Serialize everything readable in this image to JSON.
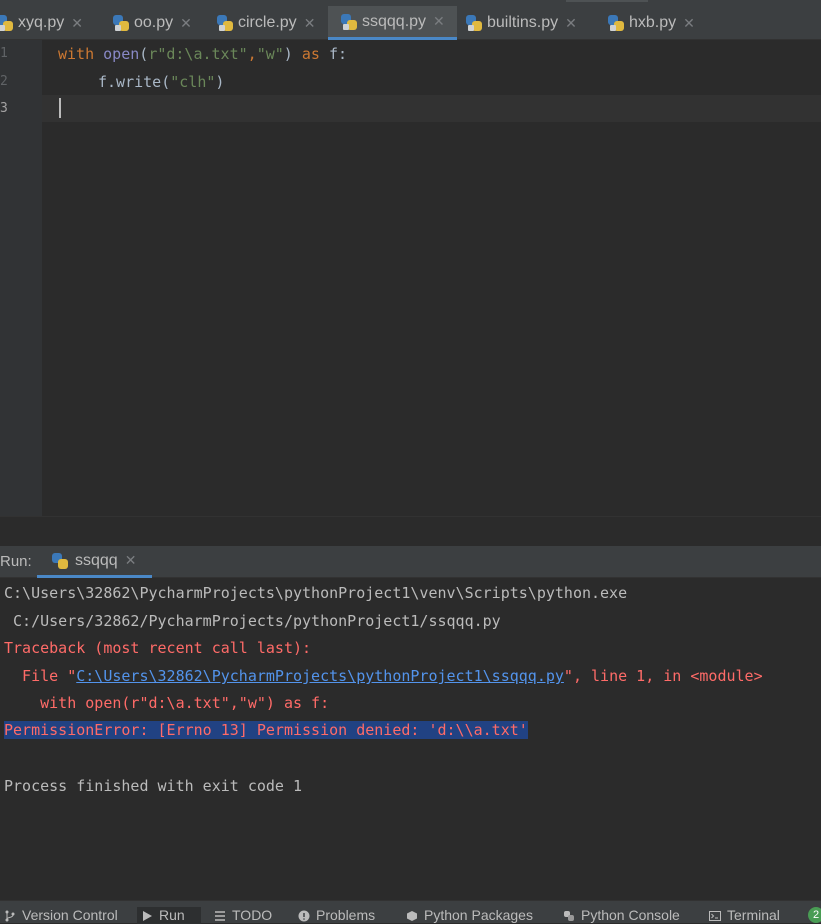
{
  "tabs": [
    {
      "label": "xyq.py",
      "active": false
    },
    {
      "label": "oo.py",
      "active": false
    },
    {
      "label": "circle.py",
      "active": false
    },
    {
      "label": "ssqqq.py",
      "active": true
    },
    {
      "label": "builtins.py",
      "active": false
    },
    {
      "label": "hxb.py",
      "active": false
    }
  ],
  "editor": {
    "line_numbers": [
      "1",
      "2",
      "3"
    ],
    "code": {
      "l1_with": "with",
      "l1_open": "open",
      "l1_paren": "(",
      "l1_str": "r\"d:\\a.txt\"",
      "l1_comma": ",",
      "l1_mode": "\"w\"",
      "l1_close": ")",
      "l1_as": "as",
      "l1_var": "f:",
      "l2_call": "f.write(",
      "l2_str": "\"clh\"",
      "l2_close": ")"
    }
  },
  "run": {
    "label": "Run:",
    "tab_label": "ssqqq",
    "console": {
      "cmd_line1": "C:\\Users\\32862\\PycharmProjects\\pythonProject1\\venv\\Scripts\\python.exe",
      "cmd_line2": " C:/Users/32862/PycharmProjects/pythonProject1/ssqqq.py",
      "traceback": "Traceback (most recent call last):",
      "file_prefix": "  File \"",
      "file_link": "C:\\Users\\32862\\PycharmProjects\\pythonProject1\\ssqqq.py",
      "file_suffix": "\", line 1, in <module>",
      "code_line": "    with open(r\"d:\\a.txt\",\"w\") as f:",
      "error": "PermissionError: [Errno 13] Permission denied: 'd:\\\\a.txt'",
      "finished": "Process finished with exit code 1"
    }
  },
  "toolwindows": [
    {
      "label": "Version Control",
      "icon": "branch-icon"
    },
    {
      "label": "Run",
      "icon": "play-icon"
    },
    {
      "label": "TODO",
      "icon": "list-icon"
    },
    {
      "label": "Problems",
      "icon": "warning-icon"
    },
    {
      "label": "Python Packages",
      "icon": "packages-icon"
    },
    {
      "label": "Python Console",
      "icon": "python-icon"
    },
    {
      "label": "Terminal",
      "icon": "terminal-icon"
    }
  ],
  "badge": "2"
}
